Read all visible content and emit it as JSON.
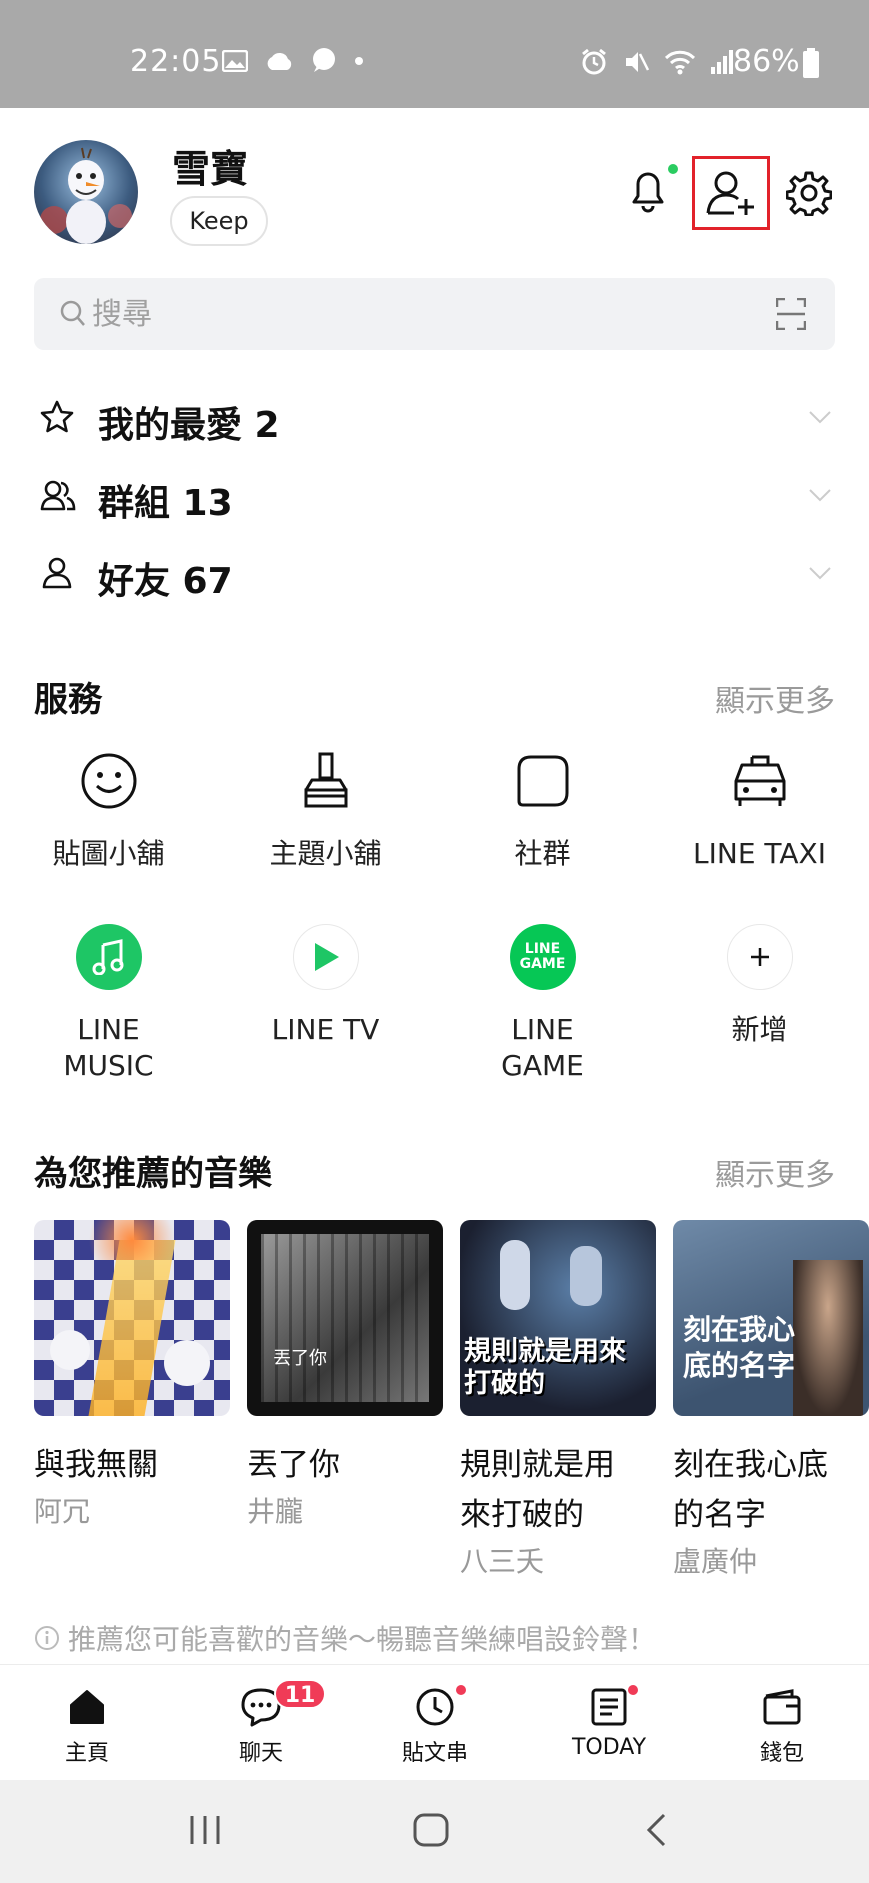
{
  "status_bar": {
    "time": "22:05",
    "battery": "86%"
  },
  "profile": {
    "name": "雪寶",
    "keep_label": "Keep"
  },
  "search": {
    "placeholder": "搜尋"
  },
  "friend_sections": [
    {
      "label": "我的最愛 2",
      "icon": "star-icon"
    },
    {
      "label": "群組 13",
      "icon": "group-icon"
    },
    {
      "label": "好友 67",
      "icon": "person-icon"
    }
  ],
  "services": {
    "title": "服務",
    "more": "顯示更多",
    "items": [
      {
        "label": "貼圖小舖",
        "icon": "smiley-icon"
      },
      {
        "label": "主題小舖",
        "icon": "brush-icon"
      },
      {
        "label": "社群",
        "icon": "openchat-icon"
      },
      {
        "label": "LINE TAXI",
        "icon": "taxi-icon"
      },
      {
        "label": "LINE MUSIC",
        "icon": "line-music-icon",
        "color": "#1ec665"
      },
      {
        "label": "LINE TV",
        "icon": "line-tv-icon",
        "color": "#1ec665"
      },
      {
        "label": "LINE GAME",
        "icon": "line-game-icon",
        "color": "#06c755",
        "logo_text": "LINE GAME"
      },
      {
        "label": "新增",
        "icon": "plus-icon"
      }
    ]
  },
  "music": {
    "title": "為您推薦的音樂",
    "more": "顯示更多",
    "cards": [
      {
        "song": "與我無關",
        "artist": "阿冗"
      },
      {
        "song": "丟了你",
        "artist": "井朧",
        "cover_text": "丟了你"
      },
      {
        "song": "規則就是用來打破的",
        "artist": "八三夭",
        "cover_text": "規則就是用來打破的"
      },
      {
        "song": "刻在我心底的名字",
        "artist": "盧廣仲",
        "cover_text": "刻在我心底的名字"
      }
    ],
    "tip": "推薦您可能喜歡的音樂～暢聽音樂練唱設鈴聲！"
  },
  "tabs": [
    {
      "label": "主頁",
      "icon": "home-icon"
    },
    {
      "label": "聊天",
      "icon": "chat-icon",
      "badge": "11"
    },
    {
      "label": "貼文串",
      "icon": "timeline-icon"
    },
    {
      "label": "TODAY",
      "icon": "today-icon"
    },
    {
      "label": "錢包",
      "icon": "wallet-icon"
    }
  ],
  "colors": {
    "accent_green": "#06c755",
    "badge_red": "#f03b57",
    "highlight_red": "#e2222a"
  }
}
